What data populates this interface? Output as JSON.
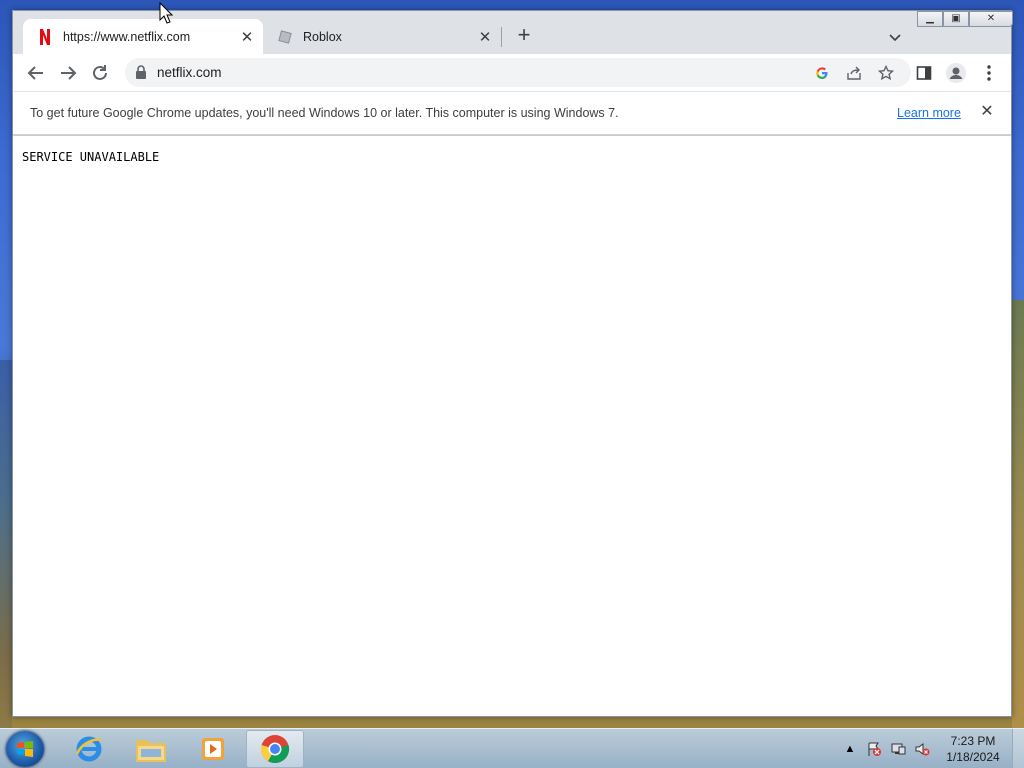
{
  "browser": {
    "tabs": [
      {
        "title": "https://www.netflix.com",
        "favicon": "netflix-icon",
        "active": true
      },
      {
        "title": "Roblox",
        "favicon": "roblox-icon",
        "active": false
      }
    ],
    "address": "netflix.com",
    "infobar": {
      "message": "To get future Google Chrome updates, you'll need Windows 10 or later. This computer is using Windows 7.",
      "link": "Learn more"
    },
    "page_text": "SERVICE UNAVAILABLE"
  },
  "taskbar": {
    "apps": [
      "internet-explorer-icon",
      "file-explorer-icon",
      "media-player-icon",
      "chrome-icon"
    ],
    "clock": {
      "time": "7:23 PM",
      "date": "1/18/2024"
    },
    "tray_expand": "▲"
  },
  "colors": {
    "accent": "#1a73e8",
    "netflix": "#e50914"
  }
}
